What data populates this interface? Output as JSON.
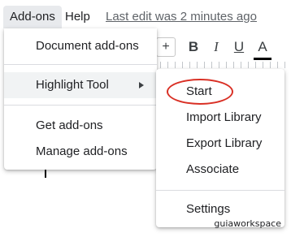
{
  "menubar": {
    "addons": "Add-ons",
    "help": "Help",
    "last_edit": "Last edit was 2 minutes ago"
  },
  "toolbar": {
    "plus": "+",
    "bold": "B",
    "italic": "I",
    "underline": "U",
    "text_color": "A"
  },
  "addons_menu": {
    "items": [
      {
        "label": "Document add-ons"
      },
      {
        "label": "Highlight Tool"
      },
      {
        "label": "Get add-ons"
      },
      {
        "label": "Manage add-ons"
      }
    ]
  },
  "submenu": {
    "items": [
      {
        "label": "Start"
      },
      {
        "label": "Import Library"
      },
      {
        "label": "Export Library"
      },
      {
        "label": "Associate"
      },
      {
        "label": "Settings"
      }
    ]
  },
  "watermark": "guiaworkspace",
  "colors": {
    "highlight_ring": "#d93025",
    "menu_hover": "#f1f3f4",
    "active_tab": "#e8eaed"
  }
}
